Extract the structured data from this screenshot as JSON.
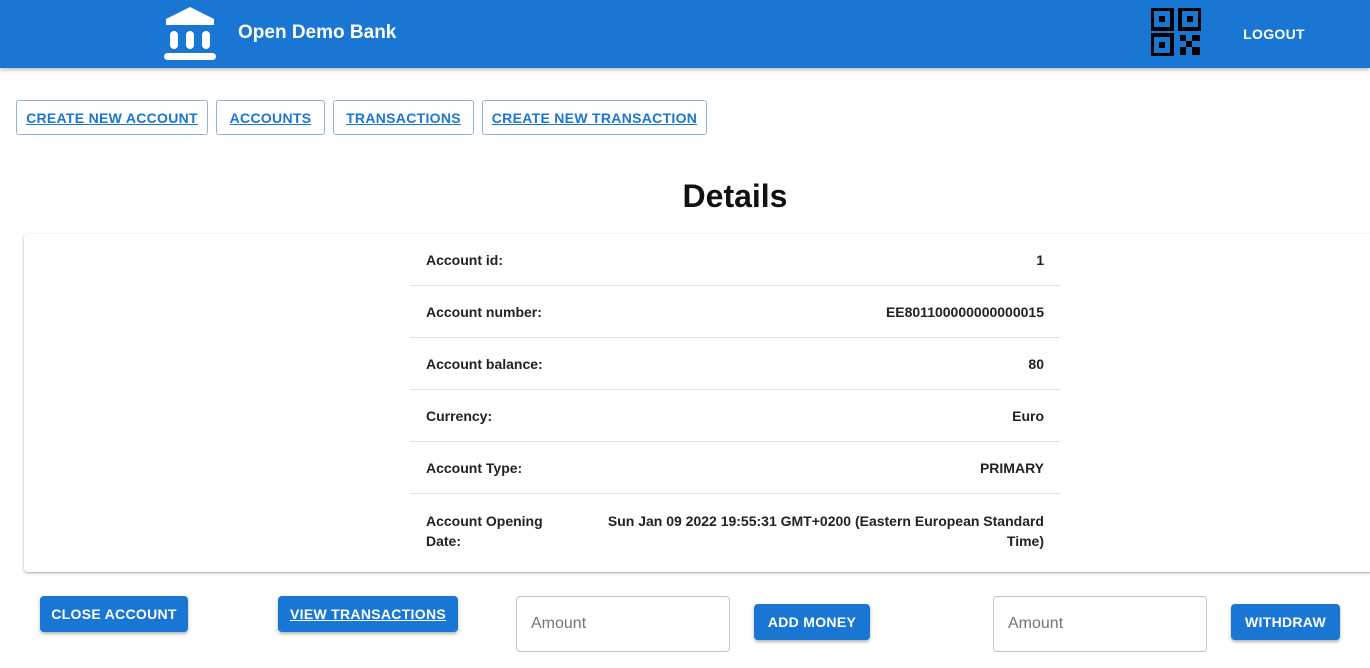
{
  "app": {
    "title": "Open Demo Bank",
    "logout_label": "LOGOUT"
  },
  "colors": {
    "primary": "#1976d2",
    "white": "#ffffff",
    "divider": "#e0e0e0"
  },
  "icons": {
    "logo": "bank-building-icon",
    "qr": "qr-code-icon"
  },
  "nav": {
    "create_account": "CREATE NEW ACCOUNT",
    "accounts": "ACCOUNTS",
    "transactions": "TRANSACTIONS",
    "create_transaction": "CREATE NEW TRANSACTION"
  },
  "page": {
    "title": "Details"
  },
  "details": {
    "rows": [
      {
        "label": "Account id:",
        "value": "1"
      },
      {
        "label": "Account number:",
        "value": "EE801100000000000015"
      },
      {
        "label": "Account balance:",
        "value": "80"
      },
      {
        "label": "Currency:",
        "value": "Euro"
      },
      {
        "label": "Account Type:",
        "value": "PRIMARY"
      },
      {
        "label": "Account Opening Date:",
        "value": "Sun Jan 09 2022 19:55:31 GMT+0200 (Eastern European Standard Time)"
      }
    ]
  },
  "actions": {
    "close_account": "CLOSE ACCOUNT",
    "view_transactions": "VIEW TRANSACTIONS",
    "add_amount_placeholder": "Amount",
    "add_money": "ADD MONEY",
    "withdraw_amount_placeholder": "Amount",
    "withdraw": "WITHDRAW"
  }
}
